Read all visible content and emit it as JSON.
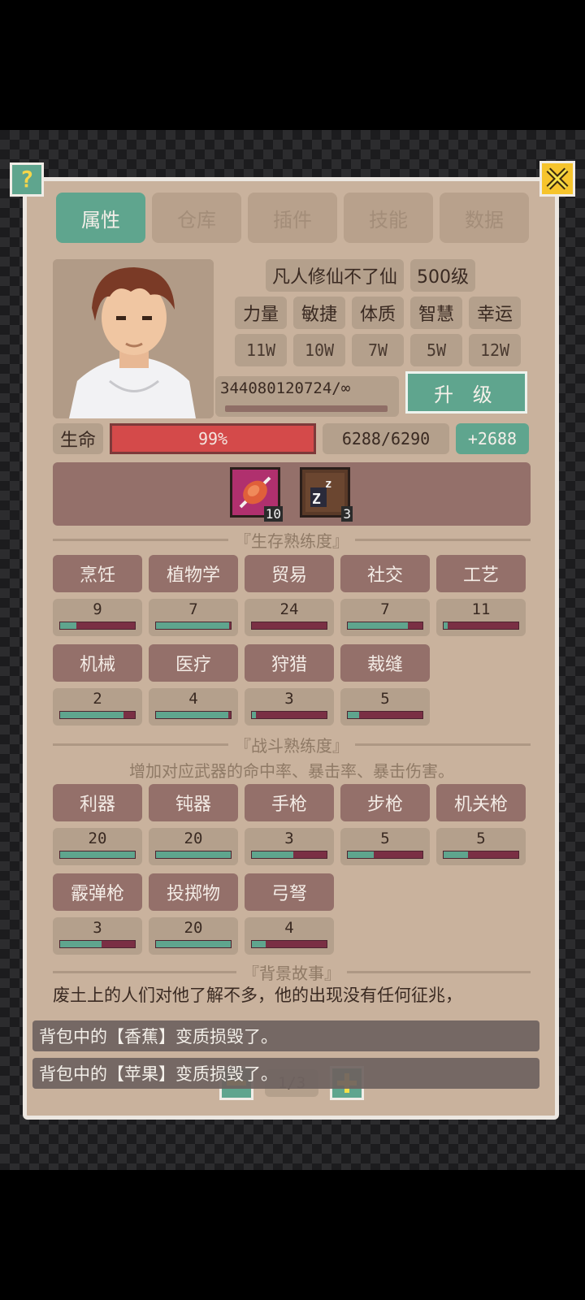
{
  "tabs": [
    {
      "label": "属性"
    },
    {
      "label": "仓库"
    },
    {
      "label": "插件"
    },
    {
      "label": "技能"
    },
    {
      "label": "数据"
    }
  ],
  "character": {
    "name": "凡人修仙不了仙",
    "level": "500级",
    "attributes": [
      {
        "name": "力量",
        "value": "11W"
      },
      {
        "name": "敏捷",
        "value": "10W"
      },
      {
        "name": "体质",
        "value": "7W"
      },
      {
        "name": "智慧",
        "value": "5W"
      },
      {
        "name": "幸运",
        "value": "12W"
      }
    ],
    "exp": "344080120724/∞",
    "upgrade_label": "升 级",
    "life_label": "生命",
    "life_percent": "99%",
    "hp": "6288/6290",
    "hp_bonus": "+2688"
  },
  "inventory": [
    {
      "icon": "meat-icon",
      "count": "10"
    },
    {
      "icon": "sleep-icon",
      "count": "3"
    }
  ],
  "survival": {
    "title": "『生存熟练度』",
    "skills": [
      {
        "name": "烹饪",
        "value": "9",
        "progress": 0.22
      },
      {
        "name": "植物学",
        "value": "7",
        "progress": 0.98
      },
      {
        "name": "贸易",
        "value": "24",
        "progress": 0.0
      },
      {
        "name": "社交",
        "value": "7",
        "progress": 0.8
      },
      {
        "name": "工艺",
        "value": "11",
        "progress": 0.05
      },
      {
        "name": "机械",
        "value": "2",
        "progress": 0.85
      },
      {
        "name": "医疗",
        "value": "4",
        "progress": 0.97
      },
      {
        "name": "狩猎",
        "value": "3",
        "progress": 0.05
      },
      {
        "name": "裁缝",
        "value": "5",
        "progress": 0.15
      }
    ]
  },
  "combat": {
    "title": "『战斗熟练度』",
    "description": "增加对应武器的命中率、暴击率、暴击伤害。",
    "skills": [
      {
        "name": "利器",
        "value": "20",
        "progress": 1.0
      },
      {
        "name": "钝器",
        "value": "20",
        "progress": 1.0
      },
      {
        "name": "手枪",
        "value": "3",
        "progress": 0.55
      },
      {
        "name": "步枪",
        "value": "5",
        "progress": 0.35
      },
      {
        "name": "机关枪",
        "value": "5",
        "progress": 0.33
      },
      {
        "name": "霰弹枪",
        "value": "3",
        "progress": 0.55
      },
      {
        "name": "投掷物",
        "value": "20",
        "progress": 1.0
      },
      {
        "name": "弓弩",
        "value": "4",
        "progress": 0.18
      }
    ]
  },
  "background": {
    "title": "『背景故事』",
    "text": "废土上的人们对他了解不多，他的出现没有任何征兆，"
  },
  "toasts": [
    "背包中的【香蕉】变质损毁了。",
    "背包中的【苹果】变质损毁了。"
  ],
  "pager": {
    "label": "1/3"
  },
  "colors": {
    "accent": "#5fa58e",
    "panel": "#c9b29d",
    "skill_bg": "#94706a",
    "life": "#d44a4a"
  }
}
